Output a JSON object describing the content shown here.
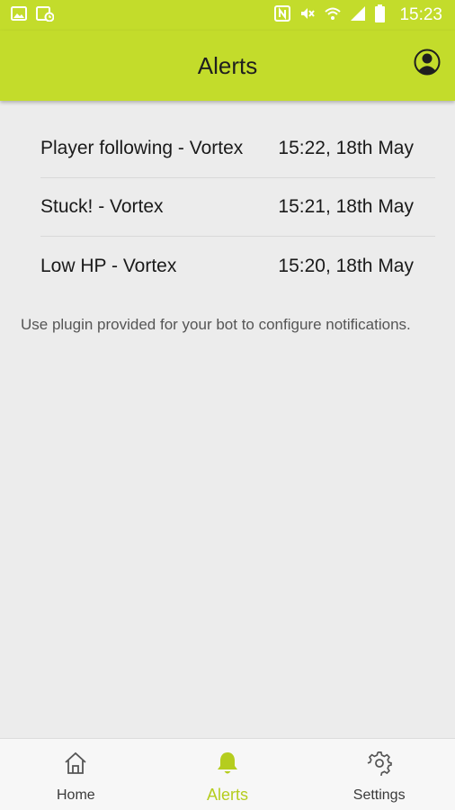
{
  "status_bar": {
    "time": "15:23"
  },
  "app_bar": {
    "title": "Alerts",
    "account_icon": "account-circle-icon"
  },
  "alerts": [
    {
      "title": "Player following - Vortex",
      "time": "15:22, 18th May"
    },
    {
      "title": "Stuck! - Vortex",
      "time": "15:21, 18th May"
    },
    {
      "title": "Low HP - Vortex",
      "time": "15:20, 18th May"
    }
  ],
  "info_text": "Use plugin provided for your bot to configure notifications.",
  "bottom_nav": {
    "items": [
      {
        "label": "Home",
        "icon": "home-icon",
        "active": false
      },
      {
        "label": "Alerts",
        "icon": "bell-icon",
        "active": true
      },
      {
        "label": "Settings",
        "icon": "gear-icon",
        "active": false
      }
    ]
  },
  "colors": {
    "accent": "#c3dc2b",
    "active_nav": "#b5cd1e",
    "background": "#ececec"
  }
}
